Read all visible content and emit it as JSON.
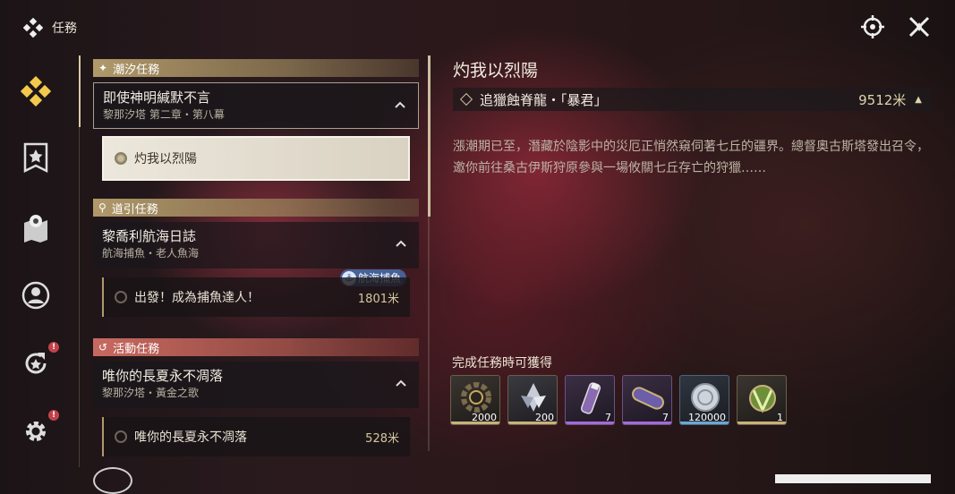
{
  "header": {
    "title": "任務"
  },
  "top_actions": [
    "target-icon",
    "close-icon"
  ],
  "sidebar": {
    "items": [
      {
        "icon": "diamond-quest-icon",
        "active": true
      },
      {
        "icon": "banner-star-icon"
      },
      {
        "icon": "map-pin-icon"
      },
      {
        "icon": "person-icon"
      },
      {
        "icon": "return-icon",
        "badge": "!"
      },
      {
        "icon": "gear-icon",
        "badge": "!"
      }
    ]
  },
  "quest_list": {
    "categories": [
      {
        "label": "潮汐任務",
        "quest": {
          "title": "即使神明緘默不言",
          "subtitle": "黎那汐塔 第二章・第八幕"
        },
        "step": {
          "label": "灼我以烈陽"
        }
      },
      {
        "label": "道引任務",
        "quest": {
          "title": "黎喬利航海日誌",
          "subtitle": "航海捕魚・老人魚海"
        },
        "tag": "航海捕魚",
        "step": {
          "label": "出發！成為捕魚達人！",
          "distance": "1801米"
        }
      },
      {
        "label": "活動任務",
        "quest": {
          "title": "唯你的長夏永不凋落",
          "subtitle": "黎那汐塔・黃金之歌"
        },
        "step": {
          "label": "唯你的長夏永不凋落",
          "distance": "528米"
        }
      }
    ]
  },
  "detail": {
    "title": "灼我以烈陽",
    "objective": {
      "label": "追獵蝕脊龍・「暴君」",
      "distance": "9512米"
    },
    "description": "漲潮期已至，潛藏於陰影中的災厄正悄然窺伺著七丘的疆界。總督奧古斯塔發出召令，邀你前往桑古伊斯狩原參與一場攸關七丘存亡的狩獵……",
    "reward_label": "完成任務時可獲得",
    "rewards": [
      {
        "icon": "gear-coin-icon",
        "count": "2000",
        "rarity_color": "#c9b27a"
      },
      {
        "icon": "crystal-shard-icon",
        "count": "200",
        "rarity_color": "#c9b27a"
      },
      {
        "icon": "purple-vial-icon",
        "count": "7",
        "rarity_color": "#a46ad6"
      },
      {
        "icon": "capsule-icon",
        "count": "7",
        "rarity_color": "#a46ad6"
      },
      {
        "icon": "shell-coin-icon",
        "count": "120000",
        "rarity_color": "#6aa8d6"
      },
      {
        "icon": "green-orb-icon",
        "count": "1",
        "rarity_color": "#c9b27a"
      }
    ]
  }
}
